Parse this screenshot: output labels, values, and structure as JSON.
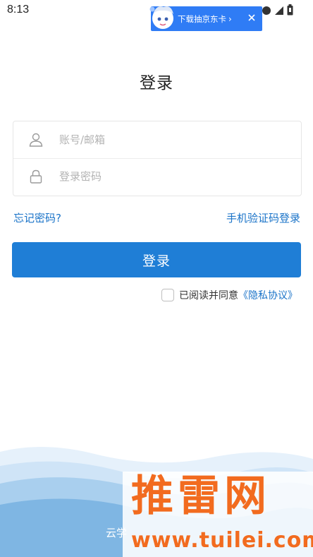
{
  "status_bar": {
    "time": "8:13"
  },
  "promo": {
    "text": "下载抽京东卡",
    "arrow": "›",
    "mascot_icon": "mascot-icon",
    "close_icon": "close-icon"
  },
  "page": {
    "title": "登录"
  },
  "form": {
    "account_placeholder": "账号/邮箱",
    "password_placeholder": "登录密码",
    "account_icon": "user-icon",
    "password_icon": "lock-icon"
  },
  "links": {
    "forgot_password": "忘记密码?",
    "sms_login": "手机验证码登录"
  },
  "login_button": {
    "label": "登录"
  },
  "agreement": {
    "prefix": "已阅读并同意",
    "link": "《隐私协议》",
    "checked": false
  },
  "footer": {
    "text": "云学"
  },
  "watermark": {
    "main": "推雷网",
    "sub": "www.tuilei.com"
  },
  "colors": {
    "accent": "#1f7ed6",
    "link": "#1a73c8",
    "promo": "#2f7cf5",
    "watermark": "#f26b1f"
  }
}
